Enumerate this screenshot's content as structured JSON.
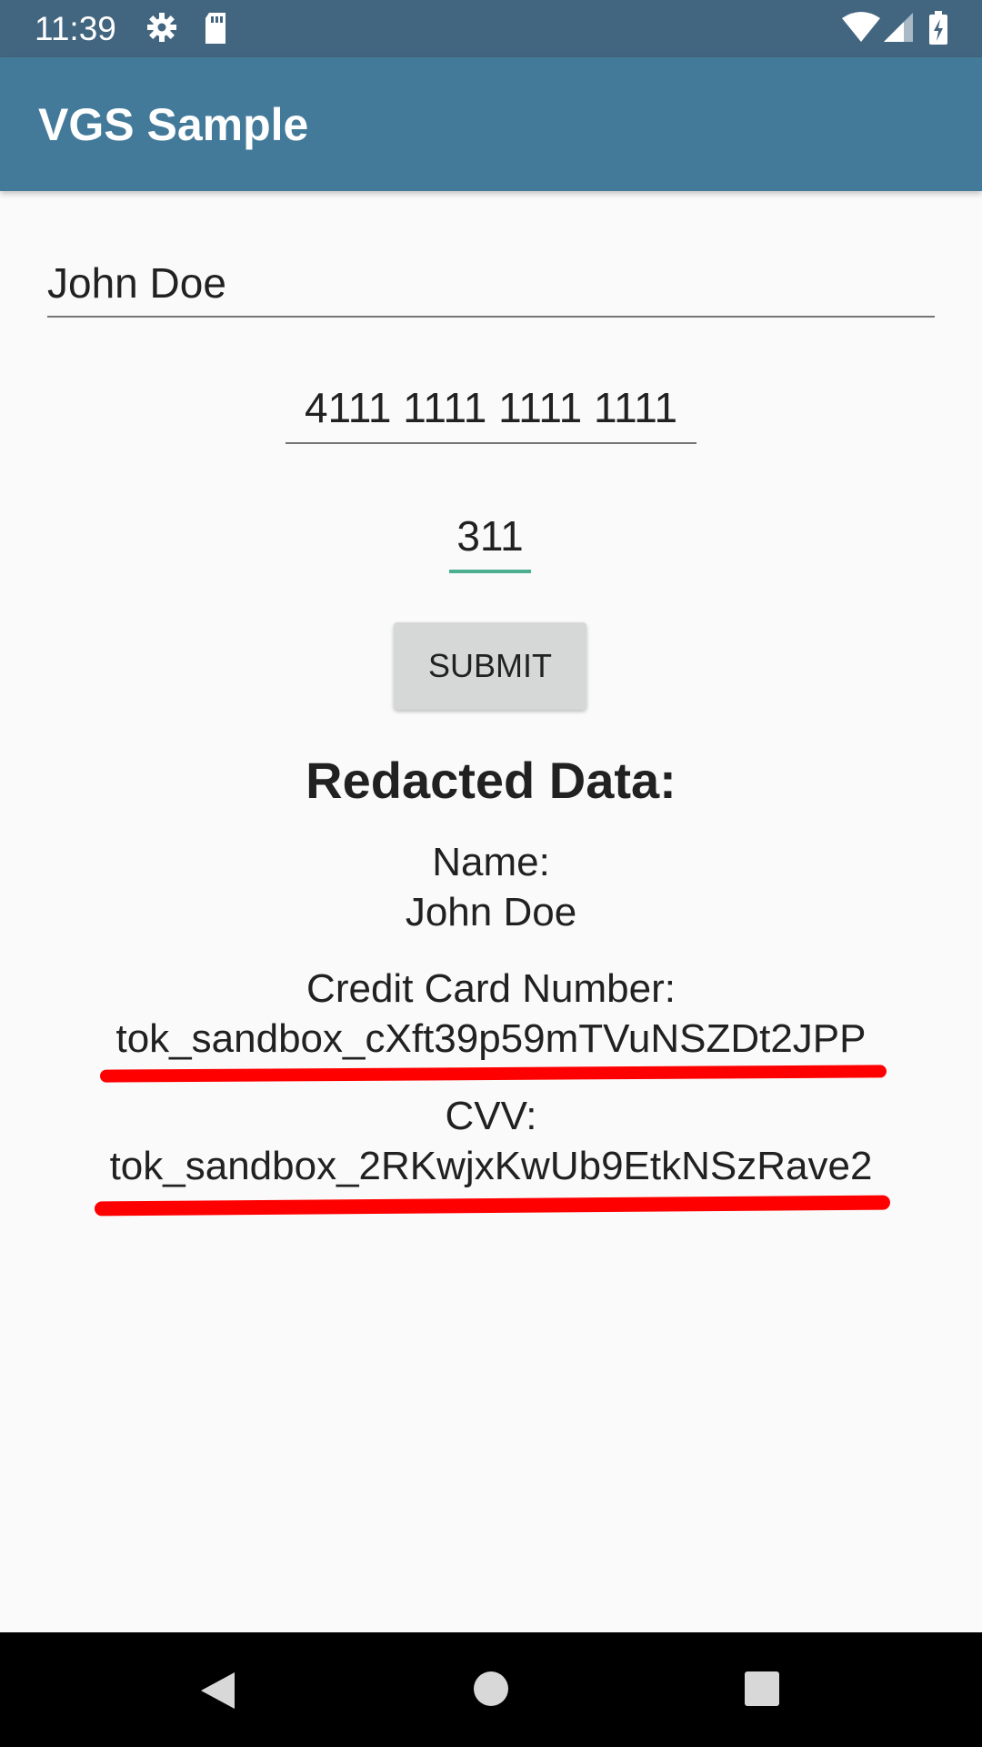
{
  "status_bar": {
    "time": "11:39",
    "icons": [
      "gear-icon",
      "sd-card-icon",
      "wifi-icon",
      "signal-icon",
      "battery-icon"
    ]
  },
  "app_bar": {
    "title": "VGS Sample"
  },
  "form": {
    "name_value": "John Doe",
    "card_number_value": "4111 1111 1111 1111",
    "cvv_value": "311",
    "submit_label": "SUBMIT"
  },
  "redacted": {
    "title": "Redacted Data:",
    "name_label": "Name:",
    "name_value": "John Doe",
    "card_label": "Credit Card Number:",
    "card_token": "tok_sandbox_cXft39p59mTVuNSZDt2JPP",
    "cvv_label": "CVV:",
    "cvv_token": "tok_sandbox_2RKwjxKwUb9EtkNSzRave2"
  },
  "navigation": {
    "icons": [
      "back-icon",
      "home-icon",
      "recent-apps-icon"
    ]
  },
  "colors": {
    "status_bar": "#426580",
    "app_bar": "#437a9a",
    "background": "#fafafa",
    "accent": "#4caf8f",
    "annotation": "#ff0000"
  }
}
